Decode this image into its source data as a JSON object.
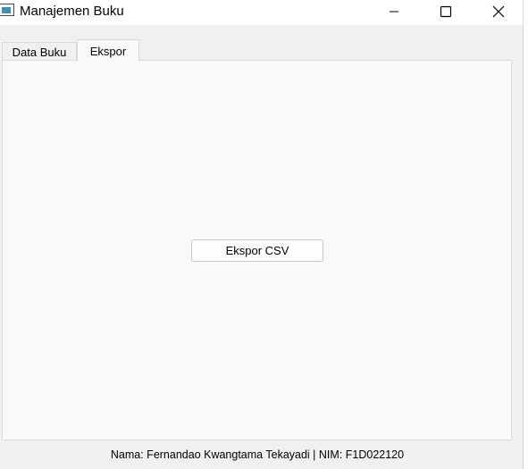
{
  "window": {
    "title": "Manajemen Buku"
  },
  "icons": {
    "app": "app-window-icon",
    "minimize": "minimize-icon",
    "maximize": "maximize-icon",
    "close": "close-icon"
  },
  "tabs": [
    {
      "label": "Data Buku",
      "active": false
    },
    {
      "label": "Ekspor",
      "active": true
    }
  ],
  "export_tab": {
    "button_label": "Ekspor CSV"
  },
  "footer": {
    "info": "Nama: Fernandao Kwangtama Tekayadi | NIM: F1D022120"
  }
}
